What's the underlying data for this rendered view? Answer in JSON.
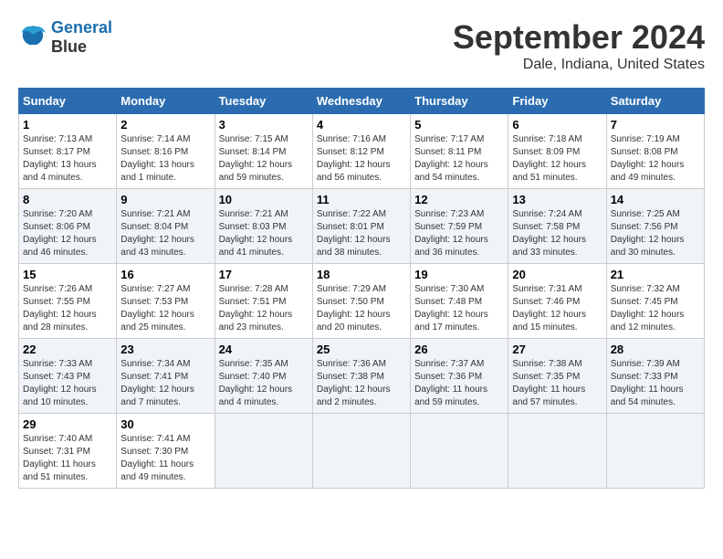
{
  "header": {
    "logo_line1": "General",
    "logo_line2": "Blue",
    "month": "September 2024",
    "location": "Dale, Indiana, United States"
  },
  "weekdays": [
    "Sunday",
    "Monday",
    "Tuesday",
    "Wednesday",
    "Thursday",
    "Friday",
    "Saturday"
  ],
  "weeks": [
    [
      {
        "day": "1",
        "info": "Sunrise: 7:13 AM\nSunset: 8:17 PM\nDaylight: 13 hours\nand 4 minutes."
      },
      {
        "day": "2",
        "info": "Sunrise: 7:14 AM\nSunset: 8:16 PM\nDaylight: 13 hours\nand 1 minute."
      },
      {
        "day": "3",
        "info": "Sunrise: 7:15 AM\nSunset: 8:14 PM\nDaylight: 12 hours\nand 59 minutes."
      },
      {
        "day": "4",
        "info": "Sunrise: 7:16 AM\nSunset: 8:12 PM\nDaylight: 12 hours\nand 56 minutes."
      },
      {
        "day": "5",
        "info": "Sunrise: 7:17 AM\nSunset: 8:11 PM\nDaylight: 12 hours\nand 54 minutes."
      },
      {
        "day": "6",
        "info": "Sunrise: 7:18 AM\nSunset: 8:09 PM\nDaylight: 12 hours\nand 51 minutes."
      },
      {
        "day": "7",
        "info": "Sunrise: 7:19 AM\nSunset: 8:08 PM\nDaylight: 12 hours\nand 49 minutes."
      }
    ],
    [
      {
        "day": "8",
        "info": "Sunrise: 7:20 AM\nSunset: 8:06 PM\nDaylight: 12 hours\nand 46 minutes."
      },
      {
        "day": "9",
        "info": "Sunrise: 7:21 AM\nSunset: 8:04 PM\nDaylight: 12 hours\nand 43 minutes."
      },
      {
        "day": "10",
        "info": "Sunrise: 7:21 AM\nSunset: 8:03 PM\nDaylight: 12 hours\nand 41 minutes."
      },
      {
        "day": "11",
        "info": "Sunrise: 7:22 AM\nSunset: 8:01 PM\nDaylight: 12 hours\nand 38 minutes."
      },
      {
        "day": "12",
        "info": "Sunrise: 7:23 AM\nSunset: 7:59 PM\nDaylight: 12 hours\nand 36 minutes."
      },
      {
        "day": "13",
        "info": "Sunrise: 7:24 AM\nSunset: 7:58 PM\nDaylight: 12 hours\nand 33 minutes."
      },
      {
        "day": "14",
        "info": "Sunrise: 7:25 AM\nSunset: 7:56 PM\nDaylight: 12 hours\nand 30 minutes."
      }
    ],
    [
      {
        "day": "15",
        "info": "Sunrise: 7:26 AM\nSunset: 7:55 PM\nDaylight: 12 hours\nand 28 minutes."
      },
      {
        "day": "16",
        "info": "Sunrise: 7:27 AM\nSunset: 7:53 PM\nDaylight: 12 hours\nand 25 minutes."
      },
      {
        "day": "17",
        "info": "Sunrise: 7:28 AM\nSunset: 7:51 PM\nDaylight: 12 hours\nand 23 minutes."
      },
      {
        "day": "18",
        "info": "Sunrise: 7:29 AM\nSunset: 7:50 PM\nDaylight: 12 hours\nand 20 minutes."
      },
      {
        "day": "19",
        "info": "Sunrise: 7:30 AM\nSunset: 7:48 PM\nDaylight: 12 hours\nand 17 minutes."
      },
      {
        "day": "20",
        "info": "Sunrise: 7:31 AM\nSunset: 7:46 PM\nDaylight: 12 hours\nand 15 minutes."
      },
      {
        "day": "21",
        "info": "Sunrise: 7:32 AM\nSunset: 7:45 PM\nDaylight: 12 hours\nand 12 minutes."
      }
    ],
    [
      {
        "day": "22",
        "info": "Sunrise: 7:33 AM\nSunset: 7:43 PM\nDaylight: 12 hours\nand 10 minutes."
      },
      {
        "day": "23",
        "info": "Sunrise: 7:34 AM\nSunset: 7:41 PM\nDaylight: 12 hours\nand 7 minutes."
      },
      {
        "day": "24",
        "info": "Sunrise: 7:35 AM\nSunset: 7:40 PM\nDaylight: 12 hours\nand 4 minutes."
      },
      {
        "day": "25",
        "info": "Sunrise: 7:36 AM\nSunset: 7:38 PM\nDaylight: 12 hours\nand 2 minutes."
      },
      {
        "day": "26",
        "info": "Sunrise: 7:37 AM\nSunset: 7:36 PM\nDaylight: 11 hours\nand 59 minutes."
      },
      {
        "day": "27",
        "info": "Sunrise: 7:38 AM\nSunset: 7:35 PM\nDaylight: 11 hours\nand 57 minutes."
      },
      {
        "day": "28",
        "info": "Sunrise: 7:39 AM\nSunset: 7:33 PM\nDaylight: 11 hours\nand 54 minutes."
      }
    ],
    [
      {
        "day": "29",
        "info": "Sunrise: 7:40 AM\nSunset: 7:31 PM\nDaylight: 11 hours\nand 51 minutes."
      },
      {
        "day": "30",
        "info": "Sunrise: 7:41 AM\nSunset: 7:30 PM\nDaylight: 11 hours\nand 49 minutes."
      },
      {
        "day": "",
        "info": ""
      },
      {
        "day": "",
        "info": ""
      },
      {
        "day": "",
        "info": ""
      },
      {
        "day": "",
        "info": ""
      },
      {
        "day": "",
        "info": ""
      }
    ]
  ]
}
